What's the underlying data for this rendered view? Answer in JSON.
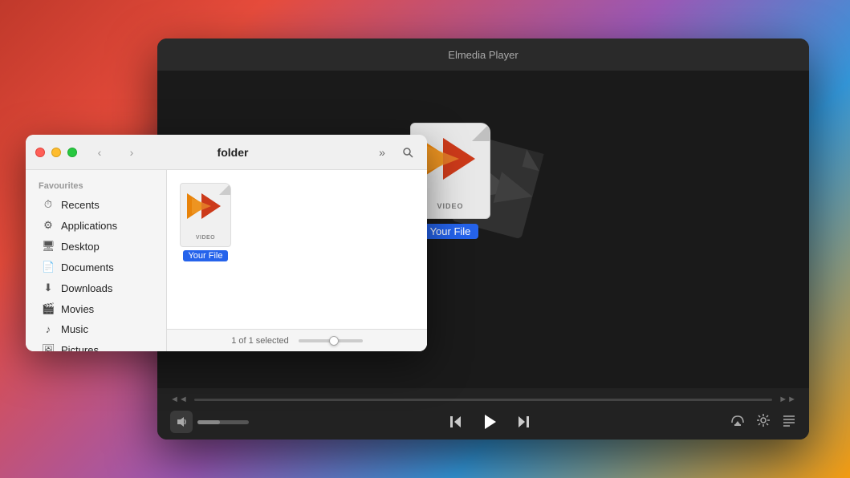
{
  "player": {
    "title": "Elmedia Player",
    "file_label": "Your File",
    "file_type": "VIDEO",
    "controls": {
      "volume_label": "volume",
      "prev_label": "previous",
      "play_label": "play",
      "next_label": "next",
      "airplay_label": "airplay",
      "settings_label": "settings",
      "playlist_label": "playlist"
    }
  },
  "finder": {
    "folder_name": "folder",
    "status_text": "1 of 1 selected",
    "sidebar": {
      "section_label": "Favourites",
      "items": [
        {
          "label": "Recents",
          "icon": "🕐"
        },
        {
          "label": "Applications",
          "icon": "⚙️"
        },
        {
          "label": "Desktop",
          "icon": "🖥"
        },
        {
          "label": "Documents",
          "icon": "📄"
        },
        {
          "label": "Downloads",
          "icon": "⬇️"
        },
        {
          "label": "Movies",
          "icon": "🎬"
        },
        {
          "label": "Music",
          "icon": "🎵"
        },
        {
          "label": "Pictures",
          "icon": "🖼"
        }
      ]
    },
    "file": {
      "name": "Your File",
      "type": "VIDEO"
    }
  }
}
